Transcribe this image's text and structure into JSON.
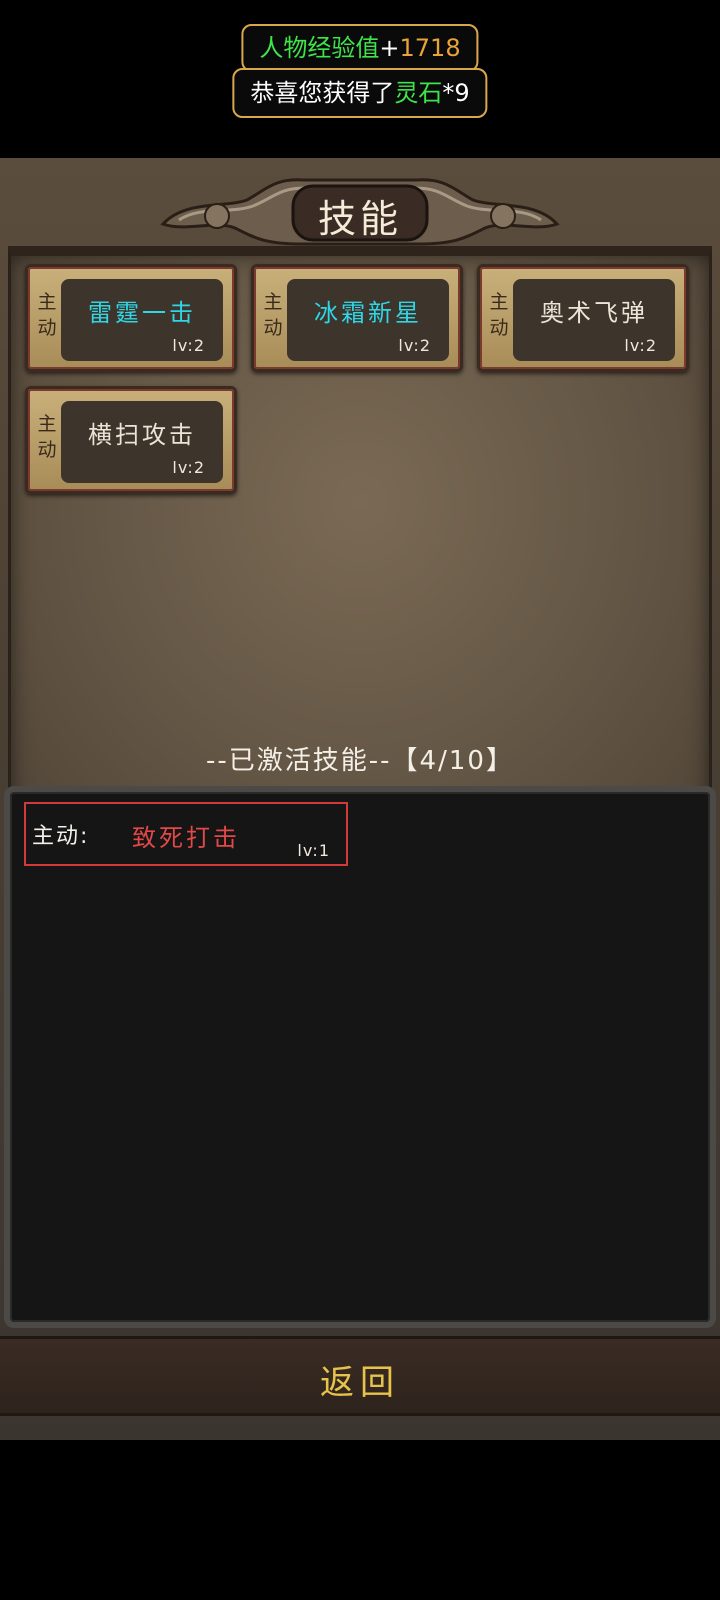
{
  "notifications": {
    "exp": {
      "label": "人物经验值",
      "plus": "+",
      "value": "1718"
    },
    "reward": {
      "prefix": "恭喜您获得了",
      "item": "灵石",
      "suffix": "*9"
    }
  },
  "panel": {
    "title": "技能"
  },
  "skills": [
    {
      "type": "主动",
      "name": "雷霆一击",
      "level": "lv:2",
      "name_color": "#2fd6e6"
    },
    {
      "type": "主动",
      "name": "冰霜新星",
      "level": "lv:2",
      "name_color": "#2fd6e6"
    },
    {
      "type": "主动",
      "name": "奥术飞弹",
      "level": "lv:2",
      "name_color": "#ece4d6"
    },
    {
      "type": "主动",
      "name": "横扫攻击",
      "level": "lv:2",
      "name_color": "#ece4d6"
    }
  ],
  "activated": {
    "label": "--已激活技能--【4/10】",
    "items": [
      {
        "type": "主动:",
        "name": "致死打击",
        "level": "lv:1",
        "name_color": "#e24848"
      }
    ]
  },
  "back_button": {
    "label": "返回"
  },
  "colors": {
    "gold_border": "#d8a84a",
    "exp_green": "#3fe34a",
    "exp_orange": "#e8a33a",
    "active_red": "#d23a3a",
    "button_text": "#e8c34a"
  },
  "icons": {
    "title_plaque": "ornate-stone-plaque-icon"
  }
}
